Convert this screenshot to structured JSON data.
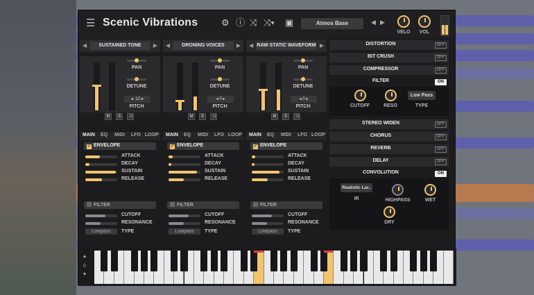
{
  "app": {
    "title": "Scenic Vibrations",
    "preset": "Atmos Base"
  },
  "master": {
    "velo_label": "VELO",
    "vol_label": "VOL"
  },
  "oscillators": [
    {
      "name": "SUSTAINED TONE",
      "pan": "PAN",
      "detune": "DETUNE",
      "pitch_value": "-12",
      "pitch": "PITCH",
      "envelope": {
        "attack": 0.45,
        "decay": 0.12,
        "sustain": 0.95,
        "release": 0.52
      },
      "filter": {
        "cutoff": 0.62,
        "resonance": 0.48,
        "type": "Lowpass"
      }
    },
    {
      "name": "DRONING VOICES",
      "pan": "PAN",
      "detune": "DETUNE",
      "pitch_value": "0",
      "pitch": "PITCH",
      "envelope": {
        "attack": 0.12,
        "decay": 0.08,
        "sustain": 0.9,
        "release": 0.48
      },
      "filter": {
        "cutoff": 0.62,
        "resonance": 0.48,
        "type": "Lowpass"
      }
    },
    {
      "name": "RAW STATIC WAVEFORM",
      "pan": "PAN",
      "detune": "DETUNE",
      "pitch_value": "0",
      "pitch": "PITCH",
      "envelope": {
        "attack": 0.1,
        "decay": 0.08,
        "sustain": 0.88,
        "release": 0.5
      },
      "filter": {
        "cutoff": 0.62,
        "resonance": 0.48,
        "type": "Lowpass"
      }
    }
  ],
  "osc_buttons": {
    "m": "M",
    "s": "S"
  },
  "tabs": [
    "MAIN",
    "EQ",
    "MIDI",
    "LFO",
    "LOOP"
  ],
  "labels": {
    "envelope": "ENVELOPE",
    "attack": "ATTACK",
    "decay": "DECAY",
    "sustain": "SUSTAIN",
    "release": "RELEASE",
    "filter": "FILTER",
    "cutoff": "CUTOFF",
    "resonance": "RESONANCE",
    "type": "TYPE"
  },
  "effects": {
    "distortion": {
      "name": "DISTORTION",
      "state": "OFF"
    },
    "bitcrush": {
      "name": "BIT CRUSH",
      "state": "OFF"
    },
    "compressor": {
      "name": "COMPRESSOR",
      "state": "OFF"
    },
    "filter": {
      "name": "FILTER",
      "state": "ON",
      "cutoff": "CUTOFF",
      "reso": "RESO",
      "type_value": "Low Pass",
      "type": "TYPE"
    },
    "stereo": {
      "name": "STEREO WIDEN",
      "state": "OFF"
    },
    "chorus": {
      "name": "CHORUS",
      "state": "OFF"
    },
    "reverb": {
      "name": "REVERB",
      "state": "OFF"
    },
    "delay": {
      "name": "DELAY",
      "state": "OFF"
    },
    "convolution": {
      "name": "CONVOLUTION",
      "state": "ON",
      "ir_value": "Realistic Lar..",
      "ir": "IR",
      "highpass": "HIGHPASS",
      "wet": "WET",
      "dry": "DRY"
    }
  },
  "keyboard": {
    "octave": "0"
  },
  "colors": {
    "accent": "#f2c46b",
    "panel": "#2a2a2d",
    "bg": "#1c1c1e"
  }
}
